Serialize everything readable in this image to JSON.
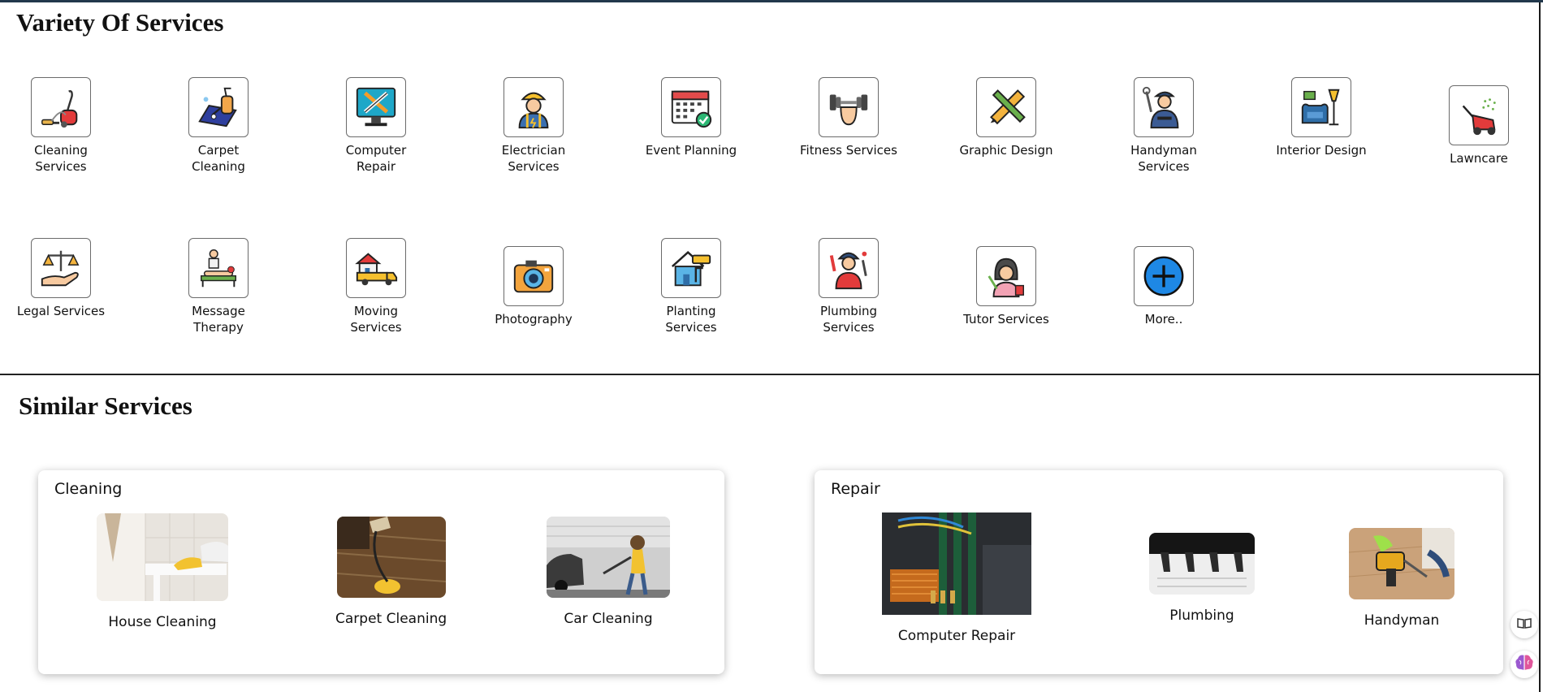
{
  "variety": {
    "title": "Variety Of Services",
    "row1": [
      {
        "label": "Cleaning Services",
        "icon": "vacuum-cleaner-icon"
      },
      {
        "label": "Carpet Cleaning",
        "icon": "carpet-cleaner-icon"
      },
      {
        "label": "Computer Repair",
        "icon": "computer-repair-icon"
      },
      {
        "label": "Electrician Services",
        "icon": "electrician-icon"
      },
      {
        "label": "Event Planning",
        "icon": "calendar-icon"
      },
      {
        "label": "Fitness Services",
        "icon": "dumbbell-icon"
      },
      {
        "label": "Graphic Design",
        "icon": "ruler-pencil-icon"
      },
      {
        "label": "Handyman Services",
        "icon": "handyman-icon"
      },
      {
        "label": "Interior Design",
        "icon": "armchair-lamp-icon"
      },
      {
        "label": "Lawncare",
        "icon": "lawn-mower-icon"
      }
    ],
    "row2": [
      {
        "label": "Legal Services",
        "icon": "scales-hand-icon"
      },
      {
        "label": "Message Therapy",
        "icon": "massage-icon"
      },
      {
        "label": "Moving Services",
        "icon": "moving-truck-icon"
      },
      {
        "label": "Photography",
        "icon": "camera-icon"
      },
      {
        "label": "Planting Services",
        "icon": "paint-house-icon"
      },
      {
        "label": "Plumbing Services",
        "icon": "plumber-icon"
      },
      {
        "label": "Tutor Services",
        "icon": "tutor-icon"
      },
      {
        "label": "More..",
        "icon": "plus-circle-icon"
      }
    ]
  },
  "similar": {
    "title": "Similar Services",
    "cleaning": {
      "title": "Cleaning",
      "items": [
        {
          "label": "House Cleaning"
        },
        {
          "label": "Carpet Cleaning"
        },
        {
          "label": "Car Cleaning"
        }
      ]
    },
    "repair": {
      "title": "Repair",
      "items": [
        {
          "label": "Computer Repair"
        },
        {
          "label": "Plumbing"
        },
        {
          "label": "Handyman"
        }
      ]
    }
  },
  "side_buttons": {
    "reader_icon": "book-reader-icon",
    "ai_icon": "brain-icon"
  },
  "colors": {
    "accent_blue": "#1e88e5",
    "border_dark": "#22384c"
  }
}
